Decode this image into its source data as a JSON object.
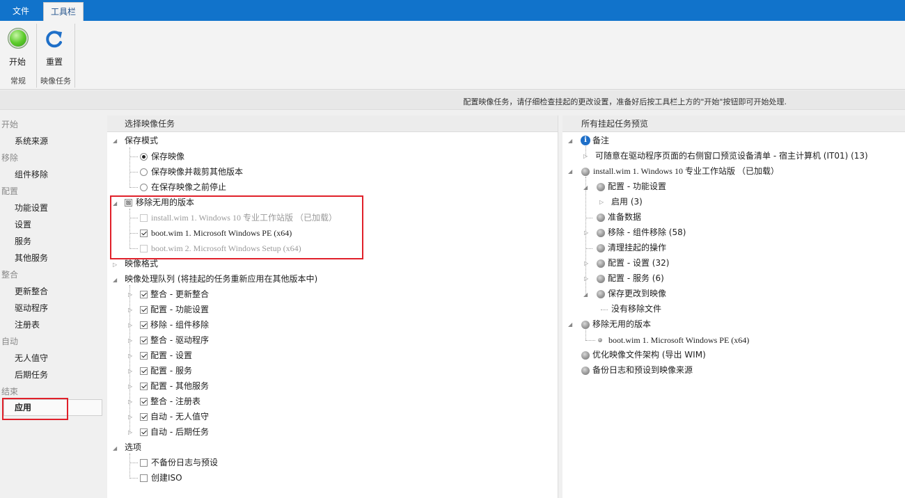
{
  "menubar": {
    "tabs": [
      {
        "label": "文件"
      },
      {
        "label": "工具栏"
      }
    ]
  },
  "ribbon": {
    "start_label": "开始",
    "reset_label": "重置",
    "group_general": "常规",
    "group_image_task": "映像任务"
  },
  "info_text": "配置映像任务，请仔细检查挂起的更改设置，准备好后按工具栏上方的\"开始\"按钮即可开始处理.",
  "leftnav": {
    "sections": [
      {
        "title": "开始",
        "items": [
          "系统来源"
        ]
      },
      {
        "title": "移除",
        "items": [
          "组件移除"
        ]
      },
      {
        "title": "配置",
        "items": [
          "功能设置",
          "设置",
          "服务",
          "其他服务"
        ]
      },
      {
        "title": "整合",
        "items": [
          "更新整合",
          "驱动程序",
          "注册表"
        ]
      },
      {
        "title": "自动",
        "items": [
          "无人值守",
          "后期任务"
        ]
      },
      {
        "title": "结束",
        "items": [
          "应用"
        ]
      }
    ]
  },
  "left_panel": {
    "header": "选择映像任务",
    "save_mode": {
      "title": "保存模式",
      "options": [
        "保存映像",
        "保存映像并裁剪其他版本",
        "在保存映像之前停止"
      ]
    },
    "remove_unused": {
      "title": "移除无用的版本",
      "items": [
        "install.wim 1. Windows 10 专业工作站版 （已加载）",
        "boot.wim 1. Microsoft Windows PE (x64)",
        "boot.wim 2. Microsoft Windows Setup (x64)"
      ]
    },
    "image_format": "映像格式",
    "queue": {
      "title": "映像处理队列 (将挂起的任务重新应用在其他版本中)",
      "items": [
        "整合 - 更新整合",
        "配置 - 功能设置",
        "移除 - 组件移除",
        "整合 - 驱动程序",
        "配置 - 设置",
        "配置 - 服务",
        "配置 - 其他服务",
        "整合 - 注册表",
        "自动 - 无人值守",
        "自动 - 后期任务"
      ]
    },
    "options": {
      "title": "选项",
      "items": [
        "不备份日志与预设",
        "创建ISO"
      ]
    }
  },
  "right_panel": {
    "header": "所有挂起任务预览",
    "note_title": "备注",
    "note_item": "可随意在驱动程序页面的右侧窗口预览设备清单 - 宿主计算机 (IT01) (13)",
    "install_title": "install.wim 1. Windows 10 专业工作站版 （已加载）",
    "install_children": [
      "配置 - 功能设置",
      "启用 (3)",
      "准备数据",
      "移除 - 组件移除 (58)",
      "清理挂起的操作",
      "配置 - 设置 (32)",
      "配置 - 服务 (6)",
      "保存更改到映像",
      "没有移除文件"
    ],
    "remove_unused_title": "移除无用的版本",
    "remove_unused_child": "boot.wim 1. Microsoft Windows PE (x64)",
    "optimize": "优化映像文件架构 (导出 WIM)",
    "backup": "备份日志和预设到映像来源"
  },
  "colors": {
    "accent": "#1173cb",
    "highlight_box": "#e0202a"
  }
}
